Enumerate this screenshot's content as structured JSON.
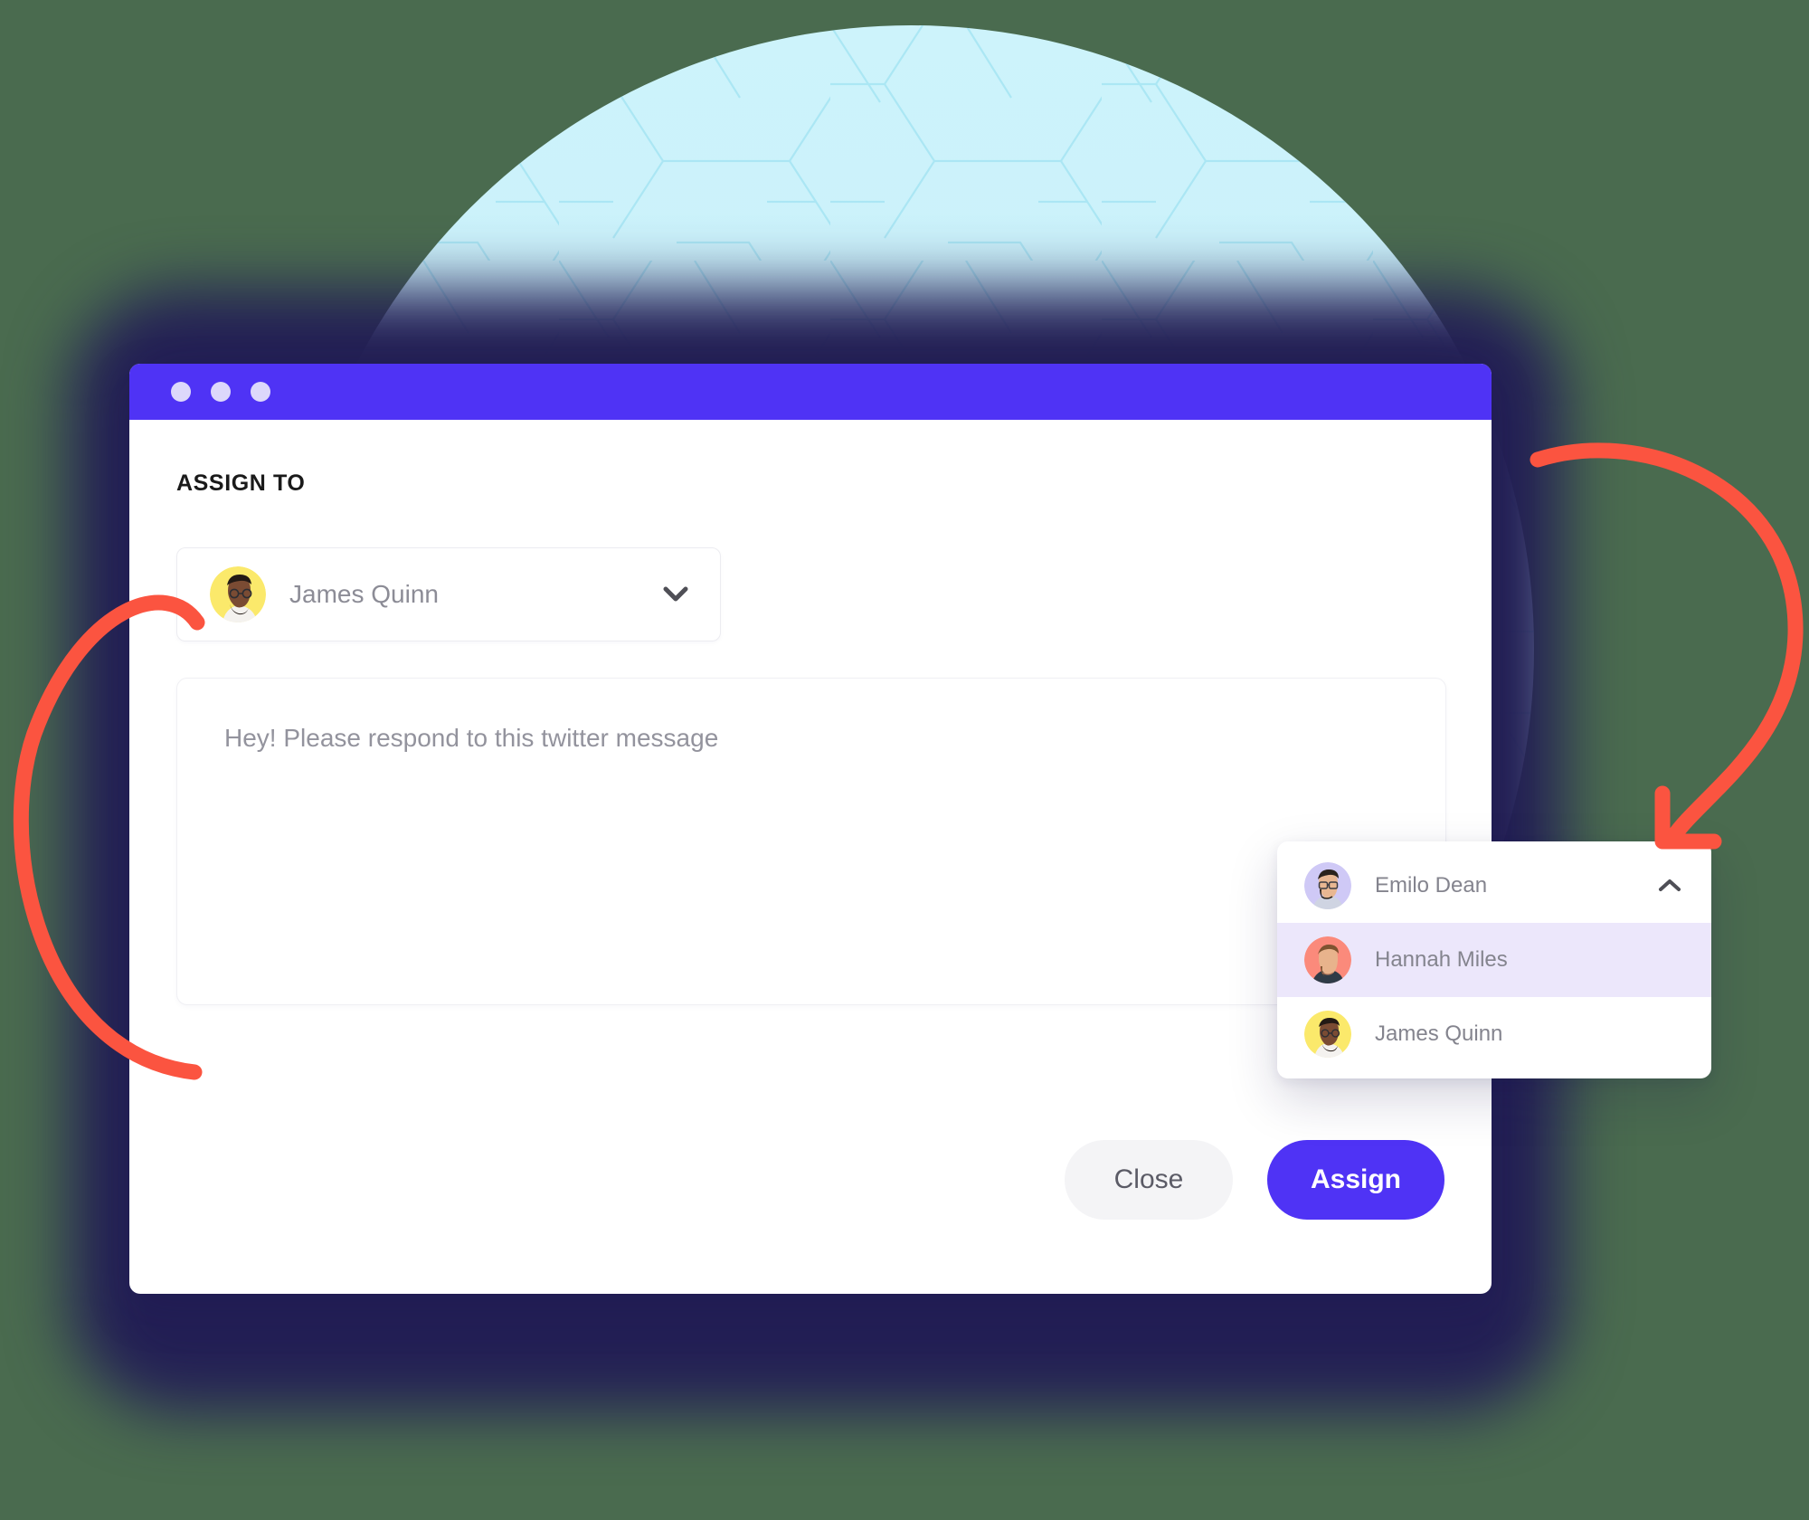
{
  "window": {
    "titlebar_dots": [
      "dot-1",
      "dot-2",
      "dot-3"
    ],
    "accent_color": "#4F33F5",
    "dot_color": "#DDD8FB"
  },
  "modal": {
    "section_label": "ASSIGN TO",
    "assignee_select": {
      "selected_name": "James Quinn",
      "avatar_bg": "#FBE96B",
      "chevron_icon": "chevron-down-icon"
    },
    "message": {
      "placeholder": "Hey! Please respond to this twitter message",
      "value": ""
    },
    "buttons": {
      "close_label": "Close",
      "assign_label": "Assign",
      "close_bg": "#F4F4F6",
      "assign_bg": "#4F33F5"
    }
  },
  "dropdown": {
    "chevron_icon": "chevron-up-icon",
    "highlight_color": "#ECE7FB",
    "items": [
      {
        "name": "Emilo Dean",
        "avatar_bg": "#CFC9F6",
        "selected": false
      },
      {
        "name": "Hannah Miles",
        "avatar_bg": "#FB8A7B",
        "selected": true
      },
      {
        "name": "James Quinn",
        "avatar_bg": "#FBE96B",
        "selected": false
      }
    ]
  },
  "decoration": {
    "backdrop_circle_color": "#C9F1FA",
    "shadow_color": "#231F55",
    "arrow_color": "#FB5440",
    "arrows": [
      {
        "name": "arrow-to-avatar",
        "points_to": "assignee-avatar"
      },
      {
        "name": "arrow-to-dropdown",
        "points_to": "assignee-dropdown"
      }
    ]
  }
}
